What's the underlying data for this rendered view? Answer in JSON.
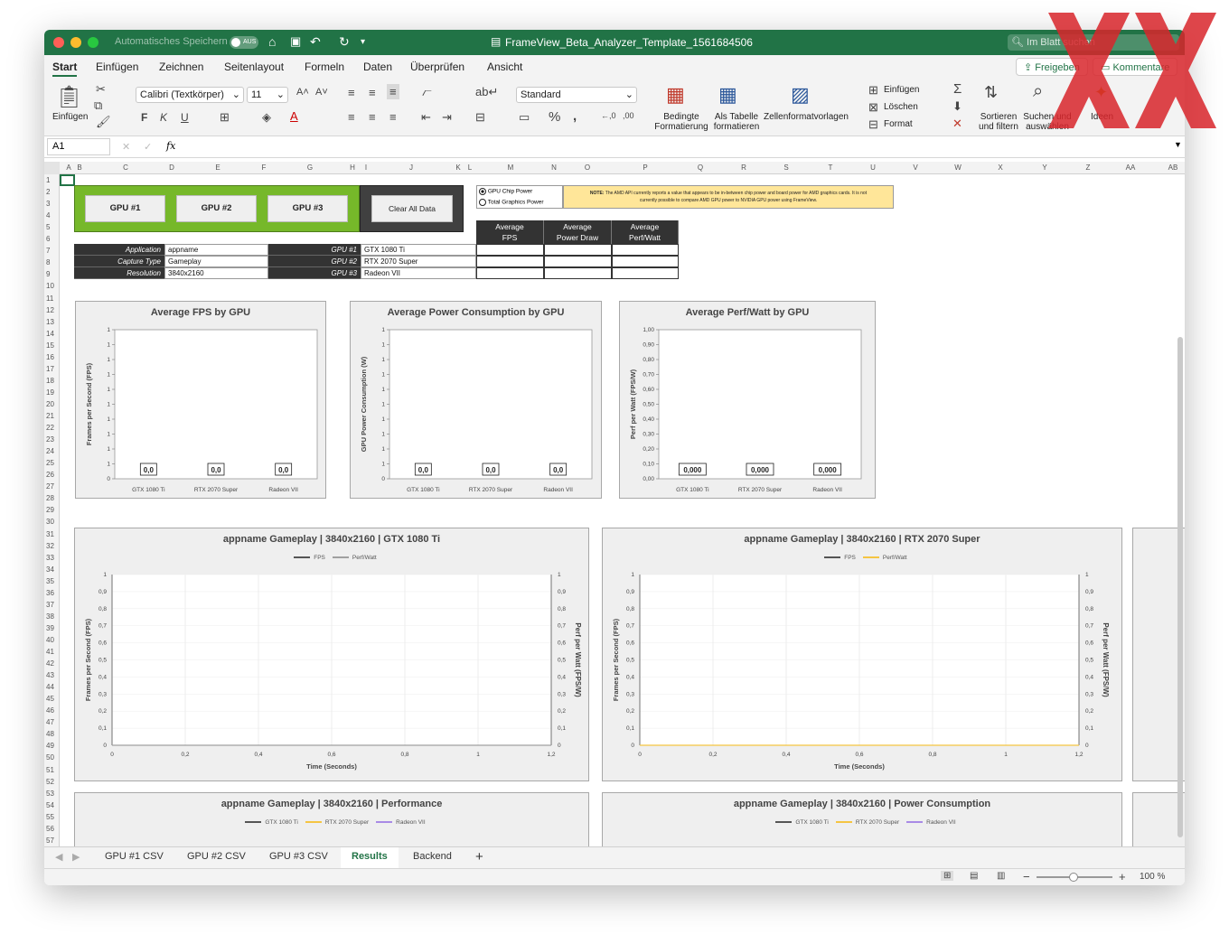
{
  "titlebar": {
    "autosave_label": "Automatisches Speichern",
    "autosave_state": "AUS",
    "doc_title": "FrameView_Beta_Analyzer_Template_1561684506",
    "search_placeholder": "Im Blatt suchen",
    "accent_color": "#217346"
  },
  "ribbon_tabs": [
    "Start",
    "Einfügen",
    "Zeichnen",
    "Seitenlayout",
    "Formeln",
    "Daten",
    "Überprüfen",
    "Ansicht"
  ],
  "share": {
    "share_label": "Freigeben",
    "comments_label": "Kommentare"
  },
  "ribbon": {
    "paste_label": "Einfügen",
    "font_name": "Calibri (Textkörper)",
    "font_size": "11",
    "bold": "F",
    "italic": "K",
    "underline": "U",
    "number_format": "Standard",
    "cond_format_label_1": "Bedingte",
    "cond_format_label_2": "Formatierung",
    "as_table_label_1": "Als Tabelle",
    "as_table_label_2": "formatieren",
    "cell_styles_label": "Zellenformatvorlagen",
    "insert_label": "Einfügen",
    "delete_label": "Löschen",
    "format_label": "Format",
    "sort_label_1": "Sortieren",
    "sort_label_2": "und filtern",
    "find_label_1": "Suchen und",
    "find_label_2": "auswählen",
    "ideas_label": "Ideen"
  },
  "formula_bar": {
    "cell_ref": "A1",
    "fx": "fx"
  },
  "columns": [
    "A",
    "B",
    "C",
    "D",
    "E",
    "F",
    "G",
    "H",
    "I",
    "J",
    "K",
    "L",
    "M",
    "N",
    "O",
    "P",
    "Q",
    "R",
    "S",
    "T",
    "U",
    "V",
    "W",
    "X",
    "Y",
    "Z",
    "AA",
    "AB"
  ],
  "rows": [
    "1",
    "2",
    "3",
    "4",
    "5",
    "6",
    "7",
    "8",
    "9",
    "10",
    "11",
    "12",
    "13",
    "14",
    "15",
    "16",
    "17",
    "18",
    "19",
    "20",
    "21",
    "22",
    "23",
    "24",
    "25",
    "26",
    "27",
    "28",
    "29",
    "30",
    "31",
    "32",
    "33",
    "34",
    "35",
    "36",
    "37",
    "38",
    "39",
    "40",
    "41",
    "42",
    "43",
    "44",
    "45",
    "46",
    "47",
    "48",
    "49",
    "50",
    "51",
    "52",
    "53",
    "54",
    "55",
    "56",
    "57"
  ],
  "sheet": {
    "gpu_buttons": [
      "GPU #1",
      "GPU #2",
      "GPU #3"
    ],
    "clear_button": "Clear All Data",
    "radio_chip": "GPU Chip Power",
    "radio_total": "Total Graphics Power",
    "note_bold": "NOTE:",
    "note_text_1": "The AMD API currently reports a value that appears to be in-between chip power and board power for AMD graphics cards. It is not",
    "note_text_2": "currently possible to compare AMD GPU power to NVIDIA GPU power using FrameView.",
    "info_labels": [
      "Application",
      "Capture Type",
      "Resolution"
    ],
    "info_values": [
      "appname",
      "Gameplay",
      "3840x2160"
    ],
    "gpu_labels": [
      "GPU #1",
      "GPU #2",
      "GPU #3"
    ],
    "gpu_values": [
      "GTX 1080 Ti",
      "RTX 2070 Super",
      "Radeon VII"
    ],
    "avg_headers": [
      [
        "Average",
        "FPS"
      ],
      [
        "Average",
        "Power Draw"
      ],
      [
        "Average",
        "Perf/Watt"
      ]
    ]
  },
  "chart_data": [
    {
      "type": "bar",
      "title": "Average FPS by GPU",
      "ylabel": "Frames per Second (FPS)",
      "categories": [
        "GTX 1080 Ti",
        "RTX 2070 Super",
        "Radeon VII"
      ],
      "values": [
        0,
        0,
        0
      ],
      "data_labels": [
        "0,0",
        "0,0",
        "0,0"
      ],
      "y_tick_labels": [
        "0",
        "1",
        "1",
        "1",
        "1",
        "1",
        "1",
        "1",
        "1",
        "1",
        "1"
      ]
    },
    {
      "type": "bar",
      "title": "Average Power Consumption by GPU",
      "ylabel": "GPU Power Consumption (W)",
      "categories": [
        "GTX 1080 Ti",
        "RTX 2070 Super",
        "Radeon VII"
      ],
      "values": [
        0,
        0,
        0
      ],
      "data_labels": [
        "0,0",
        "0,0",
        "0,0"
      ],
      "y_tick_labels": [
        "0",
        "1",
        "1",
        "1",
        "1",
        "1",
        "1",
        "1",
        "1",
        "1",
        "1"
      ]
    },
    {
      "type": "bar",
      "title": "Average Perf/Watt by GPU",
      "ylabel": "Perf per Watt (FPS/W)",
      "categories": [
        "GTX 1080 Ti",
        "RTX 2070 Super",
        "Radeon VII"
      ],
      "values": [
        0,
        0,
        0
      ],
      "data_labels": [
        "0,000",
        "0,000",
        "0,000"
      ],
      "y_tick_labels": [
        "0,00",
        "0,10",
        "0,20",
        "0,30",
        "0,40",
        "0,50",
        "0,60",
        "0,70",
        "0,80",
        "0,90",
        "1,00"
      ],
      "ylim": [
        0,
        1
      ]
    },
    {
      "type": "line",
      "title": "appname Gameplay | 3840x2160 | GTX 1080 Ti",
      "xlabel": "Time (Seconds)",
      "ylabel": "Frames per Second (FPS)",
      "y2label": "Perf per Watt (FPS/W)",
      "series": [
        {
          "name": "FPS",
          "color": "#555555",
          "values": []
        },
        {
          "name": "Perf/Watt",
          "color": "#a0a0a0",
          "values": []
        }
      ],
      "x_tick_labels": [
        "0",
        "0,2",
        "0,4",
        "0,6",
        "0,8",
        "1",
        "1,2"
      ],
      "y_tick_labels": [
        "0",
        "0,1",
        "0,2",
        "0,3",
        "0,4",
        "0,5",
        "0,6",
        "0,7",
        "0,8",
        "0,9",
        "1"
      ],
      "y2_tick_labels": [
        "0",
        "0,1",
        "0,2",
        "0,3",
        "0,4",
        "0,5",
        "0,6",
        "0,7",
        "0,8",
        "0,9",
        "1"
      ],
      "xlim": [
        0,
        1.2
      ],
      "ylim": [
        0,
        1
      ]
    },
    {
      "type": "line",
      "title": "appname Gameplay | 3840x2160 | RTX 2070 Super",
      "xlabel": "Time (Seconds)",
      "ylabel": "Frames per Second (FPS)",
      "y2label": "Perf per Watt (FPS/W)",
      "series": [
        {
          "name": "FPS",
          "color": "#555555",
          "values": []
        },
        {
          "name": "Perf/Watt",
          "color": "#f5c542",
          "values": []
        }
      ],
      "x_tick_labels": [
        "0",
        "0,2",
        "0,4",
        "0,6",
        "0,8",
        "1",
        "1,2"
      ],
      "y_tick_labels": [
        "0",
        "0,1",
        "0,2",
        "0,3",
        "0,4",
        "0,5",
        "0,6",
        "0,7",
        "0,8",
        "0,9",
        "1"
      ],
      "y2_tick_labels": [
        "0",
        "0,1",
        "0,2",
        "0,3",
        "0,4",
        "0,5",
        "0,6",
        "0,7",
        "0,8",
        "0,9",
        "1"
      ],
      "xlim": [
        0,
        1.2
      ],
      "ylim": [
        0,
        1
      ]
    },
    {
      "type": "line",
      "title": "appname Gameplay | 3840x2160 | Performance",
      "series": [
        {
          "name": "GTX 1080 Ti",
          "color": "#555555",
          "values": []
        },
        {
          "name": "RTX 2070 Super",
          "color": "#f5c542",
          "values": []
        },
        {
          "name": "Radeon VII",
          "color": "#a98be6",
          "values": []
        }
      ]
    },
    {
      "type": "line",
      "title": "appname Gameplay | 3840x2160 | Power Consumption",
      "series": [
        {
          "name": "GTX 1080 Ti",
          "color": "#555555",
          "values": []
        },
        {
          "name": "RTX 2070 Super",
          "color": "#f5c542",
          "values": []
        },
        {
          "name": "Radeon VII",
          "color": "#a98be6",
          "values": []
        }
      ]
    }
  ],
  "sheet_tabs": [
    "GPU #1 CSV",
    "GPU #2 CSV",
    "GPU #3 CSV",
    "Results",
    "Backend"
  ],
  "active_sheet": "Results",
  "status": {
    "zoom": "100 %"
  },
  "icons": [
    "home-icon",
    "save-icon",
    "undo-icon",
    "redo-icon",
    "search-icon",
    "cut-icon",
    "copy-icon",
    "format-painter-icon",
    "sum-icon",
    "sort-filter-icon",
    "find-icon",
    "ideas-icon"
  ]
}
